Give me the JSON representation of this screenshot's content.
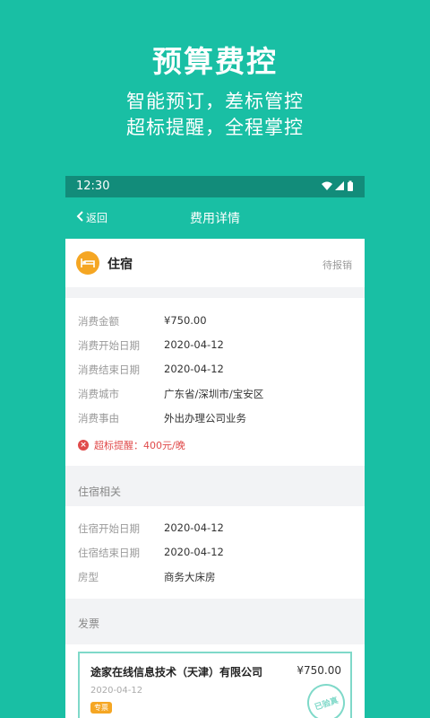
{
  "hero": {
    "title": "预算费控",
    "line1": "智能预订，差标管控",
    "line2": "超标提醒，全程掌控"
  },
  "status_bar": {
    "time": "12:30"
  },
  "app_bar": {
    "back_label": "返回",
    "title": "费用详情"
  },
  "category": {
    "icon": "bed-icon",
    "name": "住宿",
    "status": "待报销",
    "icon_color": "#F5A623"
  },
  "details": [
    {
      "label": "消费金额",
      "value": "¥750.00"
    },
    {
      "label": "消费开始日期",
      "value": "2020-04-12"
    },
    {
      "label": "消费结束日期",
      "value": "2020-04-12"
    },
    {
      "label": "消费城市",
      "value": "广东省/深圳市/宝安区"
    },
    {
      "label": "消费事由",
      "value": "外出办理公司业务"
    }
  ],
  "warning": {
    "text": "超标提醒：400元/晚",
    "color": "#E04B4B"
  },
  "hotel_section": {
    "title": "住宿相关",
    "rows": [
      {
        "label": "住宿开始日期",
        "value": "2020-04-12"
      },
      {
        "label": "住宿结束日期",
        "value": "2020-04-12"
      },
      {
        "label": "房型",
        "value": "商务大床房"
      }
    ]
  },
  "invoice_section": {
    "title": "发票",
    "invoice": {
      "company": "途家在线信息技术（天津）有限公司",
      "amount": "¥750.00",
      "date": "2020-04-12",
      "tag": "专票",
      "stamp": "已验真"
    }
  },
  "colors": {
    "brand": "#19BFA4",
    "status_bar": "#128C7A",
    "stamp": "#7FD9C9"
  }
}
